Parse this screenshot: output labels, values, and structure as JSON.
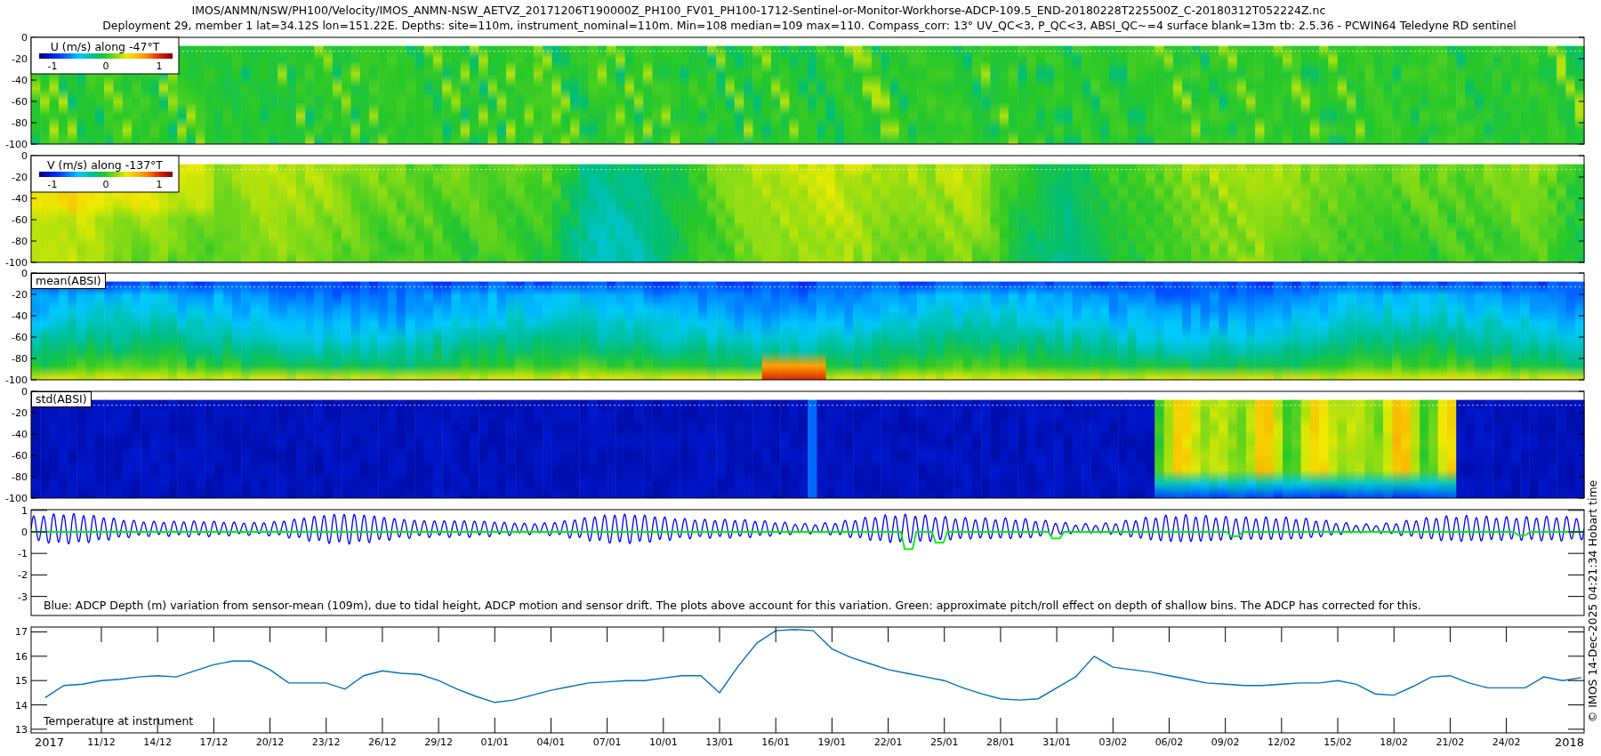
{
  "title_lines": [
    "IMOS/ANMN/NSW/PH100/Velocity/IMOS_ANMN-NSW_AETVZ_20171206T190000Z_PH100_FV01_PH100-1712-Sentinel-or-Monitor-Workhorse-ADCP-109.5_END-20180228T225500Z_C-20180312T052224Z.nc",
    "Deployment 29, member 1 lat=34.12S lon=151.22E. Depths: site=110m, instrument_nominal=110m. Min=108 median=109 max=110. Compass_corr: 13° UV_QC<3, P_QC<3, ABSI_QC~=4 surface blank=13m tb: 2.5.36 - PCWIN64 Teledyne RD sentinel"
  ],
  "heatmap_panels": [
    {
      "kind": "u",
      "label": "U (m/s) along -47°T",
      "colorbar_ticks": [
        "-1",
        "0",
        "1"
      ],
      "y_ticks": [
        "0",
        "-20",
        "-40",
        "-60",
        "-80",
        "-100"
      ]
    },
    {
      "kind": "v",
      "label": "V (m/s) along -137°T",
      "colorbar_ticks": [
        "-1",
        "0",
        "1"
      ],
      "y_ticks": [
        "0",
        "-20",
        "-40",
        "-60",
        "-80",
        "-100"
      ]
    },
    {
      "kind": "mean",
      "label": "mean(ABSI)",
      "y_ticks": [
        "0",
        "-20",
        "-40",
        "-60",
        "-80",
        "-100"
      ]
    },
    {
      "kind": "std",
      "label": "std(ABSI)",
      "y_ticks": [
        "0",
        "-20",
        "-40",
        "-60",
        "-80",
        "-100"
      ]
    }
  ],
  "depth_panel": {
    "y_ticks": [
      "1",
      "0",
      "-1",
      "-2",
      "-3"
    ],
    "caption": "Blue: ADCP Depth (m) variation from sensor-mean (109m), due to tidal height, ADCP motion and sensor drift. The plots above account for this variation. Green: approximate pitch/roll effect on depth of shallow bins. The ADCP has corrected for this."
  },
  "temperature_panel": {
    "chart_data": {
      "type": "line",
      "ylim": [
        12.85,
        17.2
      ],
      "yticks": [
        17,
        16,
        15,
        14,
        13
      ],
      "categories": [
        null,
        null,
        null,
        "11/12",
        null,
        null,
        "14/12",
        null,
        null,
        "17/12",
        null,
        null,
        "20/12",
        null,
        null,
        "23/12",
        null,
        null,
        "26/12",
        null,
        null,
        "29/12",
        null,
        null,
        "01/01",
        null,
        null,
        "04/01",
        null,
        null,
        "07/01",
        null,
        null,
        "10/01",
        null,
        null,
        "13/01",
        null,
        null,
        "16/01",
        null,
        null,
        "19/01",
        null,
        null,
        "22/01",
        null,
        null,
        "25/01",
        null,
        null,
        "28/01",
        null,
        null,
        "31/01",
        null,
        null,
        "03/02",
        null,
        null,
        "06/02",
        null,
        null,
        "09/02",
        null,
        null,
        "12/02",
        null,
        null,
        "15/02",
        null,
        null,
        "18/02",
        null,
        null,
        "21/02",
        null,
        null,
        "24/02",
        null,
        null,
        null,
        null
      ],
      "series": [
        {
          "name": "Temperature at instrument",
          "color": "#0072bd",
          "values": [
            14.3,
            14.8,
            14.85,
            15.0,
            15.05,
            15.15,
            15.2,
            15.15,
            15.4,
            15.65,
            15.8,
            15.8,
            15.45,
            14.9,
            14.9,
            14.9,
            14.65,
            15.2,
            15.4,
            15.3,
            15.25,
            15.0,
            14.65,
            14.35,
            14.1,
            14.2,
            14.4,
            14.6,
            14.75,
            14.9,
            14.95,
            15.0,
            15.0,
            15.1,
            15.2,
            15.2,
            14.5,
            15.6,
            16.55,
            17.05,
            17.1,
            17.05,
            16.3,
            15.95,
            15.7,
            15.45,
            15.3,
            15.15,
            15.0,
            14.7,
            14.45,
            14.25,
            14.2,
            14.25,
            14.7,
            15.15,
            16.0,
            15.55,
            15.45,
            15.35,
            15.2,
            15.05,
            14.9,
            14.85,
            14.8,
            14.8,
            14.85,
            14.9,
            14.9,
            15.0,
            14.85,
            14.45,
            14.4,
            14.75,
            15.15,
            15.2,
            14.9,
            14.7,
            14.7,
            14.7,
            15.15,
            15.0,
            15.12
          ]
        }
      ]
    }
  },
  "x_axis": {
    "year_start": "2017",
    "year_end": "2018"
  },
  "side_note": "© IMOS 14-Dec-2025 04:21:34 Hobart time"
}
